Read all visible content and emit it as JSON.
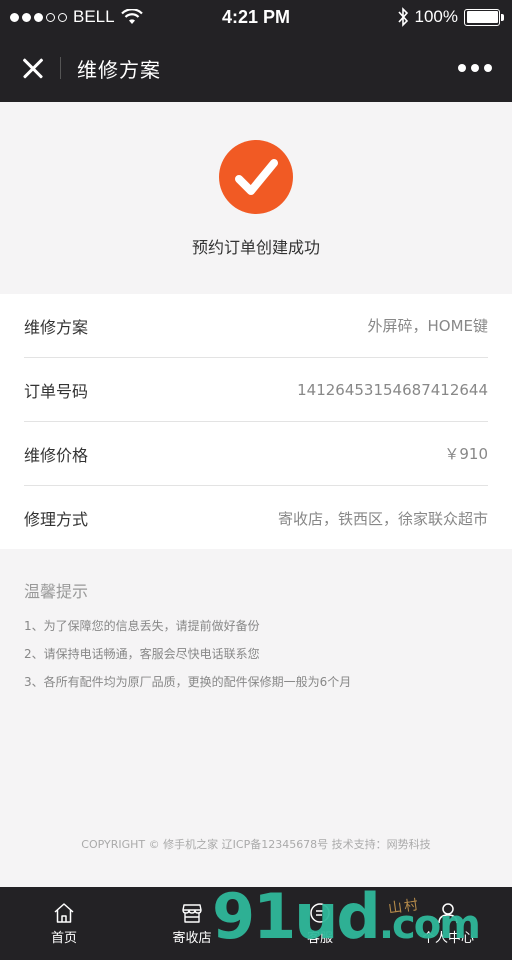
{
  "status_bar": {
    "carrier": "BELL",
    "time": "4:21 PM",
    "battery": "100%"
  },
  "nav": {
    "title": "维修方案"
  },
  "success": {
    "message": "预约订单创建成功",
    "color": "#f15a24"
  },
  "info": [
    {
      "label": "维修方案",
      "value": "外屏碎，HOME键"
    },
    {
      "label": "订单号码",
      "value": "14126453154687412644"
    },
    {
      "label": "维修价格",
      "value": "￥910"
    },
    {
      "label": "修理方式",
      "value": "寄收店，铁西区，徐家联众超市"
    }
  ],
  "tips": {
    "title": "温馨提示",
    "items": [
      "1、为了保障您的信息丢失，请提前做好备份",
      "2、请保持电话畅通，客服会尽快电话联系您",
      "3、各所有配件均为原厂品质，更换的配件保修期一般为6个月"
    ]
  },
  "copyright": "COPYRIGHT © 修手机之家 辽ICP备12345678号  技术支持：网势科技",
  "tabs": [
    {
      "label": "首页",
      "icon": "home-icon"
    },
    {
      "label": "寄收店",
      "icon": "store-icon"
    },
    {
      "label": "客服",
      "icon": "chat-icon"
    },
    {
      "label": "个人中心",
      "icon": "user-icon"
    }
  ],
  "watermark": {
    "main": "91ud",
    "suffix": ".com",
    "sub": "山村"
  }
}
